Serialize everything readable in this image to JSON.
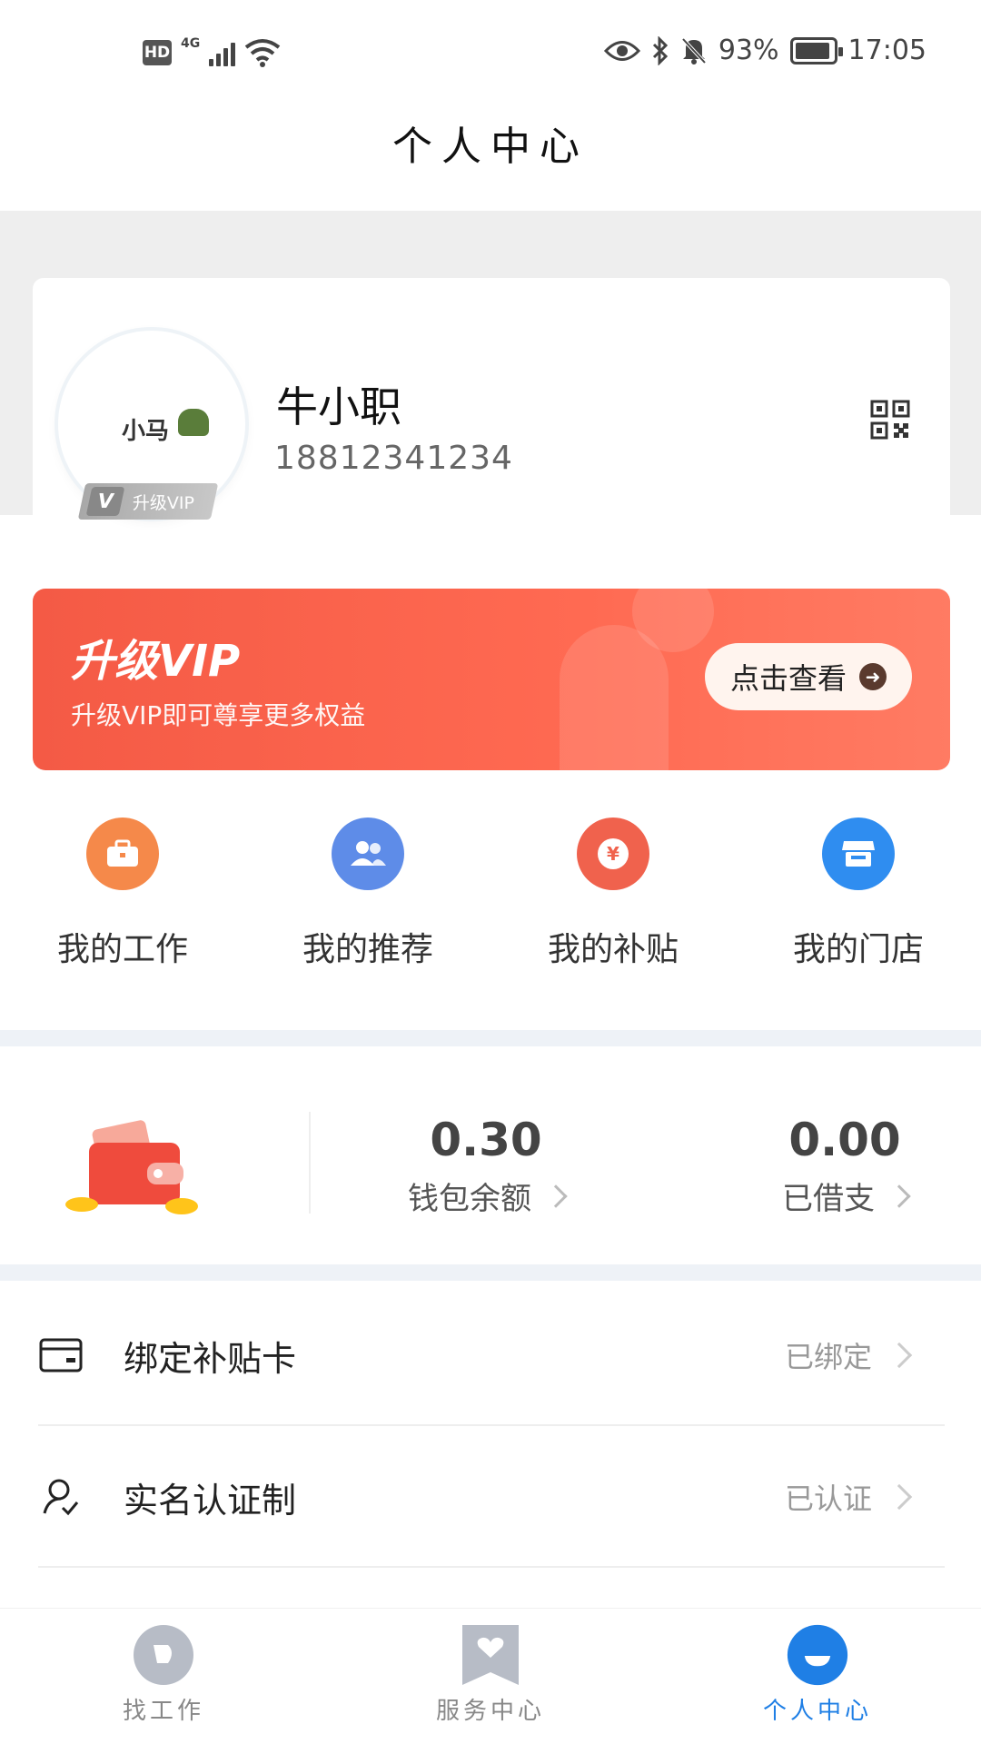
{
  "status_bar": {
    "hd": "HD",
    "network": "4G",
    "battery_percent": "93%",
    "battery_level": 0.93,
    "time": "17:05",
    "icons": [
      "eye-icon",
      "bluetooth-icon",
      "mute-bell-icon",
      "battery-icon"
    ]
  },
  "header": {
    "title": "个人中心"
  },
  "profile": {
    "name": "牛小职",
    "phone": "18812341234",
    "avatar_text": "小马",
    "vip_badge": "升级VIP",
    "vip_badge_letter": "V"
  },
  "vip_banner": {
    "title": "升级VIP",
    "subtitle": "升级VIP即可尊享更多权益",
    "button": "点击查看"
  },
  "quick_actions": [
    {
      "label": "我的工作",
      "icon": "briefcase-icon",
      "color": "#f5894a"
    },
    {
      "label": "我的推荐",
      "icon": "users-icon",
      "color": "#5e8ce8"
    },
    {
      "label": "我的补贴",
      "icon": "yuan-coin-icon",
      "color": "#f0624d"
    },
    {
      "label": "我的门店",
      "icon": "store-icon",
      "color": "#2f8df0"
    }
  ],
  "wallet": {
    "balance_value": "0.30",
    "balance_label": "钱包余额",
    "borrowed_value": "0.00",
    "borrowed_label": "已借支"
  },
  "list": [
    {
      "label": "绑定补贴卡",
      "status": "已绑定",
      "icon": "card-icon"
    },
    {
      "label": "实名认证制",
      "status": "已认证",
      "icon": "user-verify-icon"
    }
  ],
  "bottom_nav": [
    {
      "label": "找工作",
      "icon": "find-job-icon",
      "active": false
    },
    {
      "label": "服务中心",
      "icon": "service-heart-icon",
      "active": false
    },
    {
      "label": "个人中心",
      "icon": "profile-icon",
      "active": true
    }
  ],
  "colors": {
    "accent": "#1f7fe5",
    "banner": "#f45a45",
    "muted": "#999999"
  }
}
